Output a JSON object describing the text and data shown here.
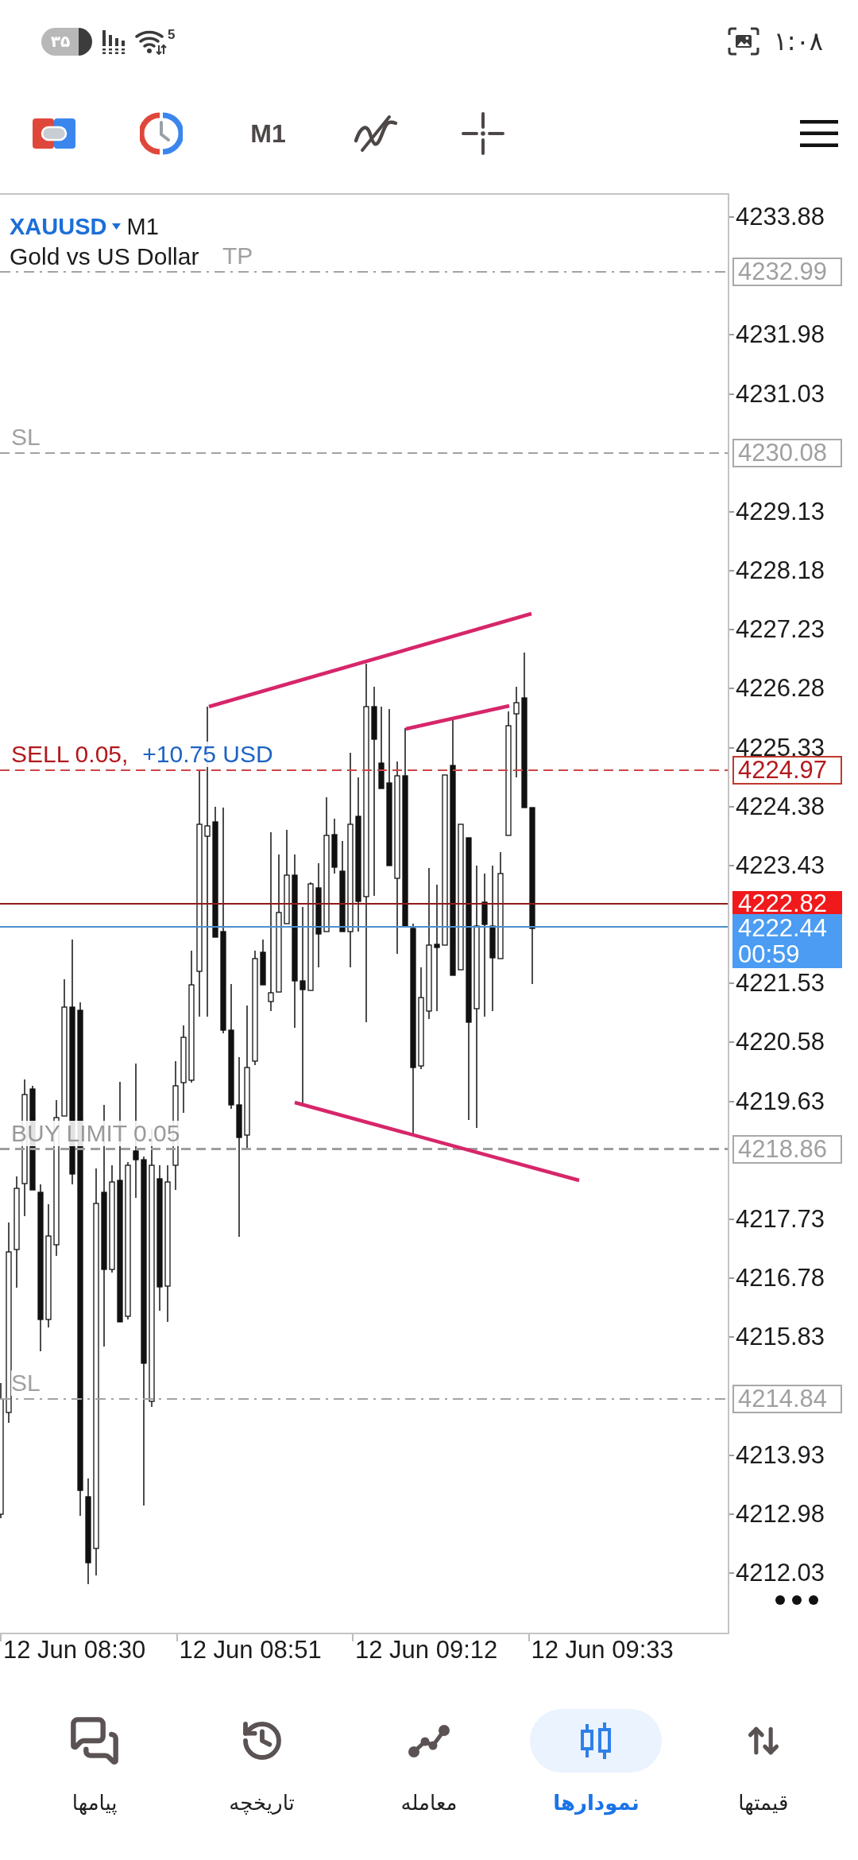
{
  "status_bar": {
    "battery": "۳۵",
    "wifi_generation": "5",
    "time": "۱:۰۸"
  },
  "toolbar": {
    "timeframe": "M1"
  },
  "chart": {
    "symbol": "XAUUSD",
    "timeframe": "M1",
    "description": "Gold vs US Dollar",
    "price_axis": [
      "4233.88",
      "4231.98",
      "4231.03",
      "4229.13",
      "4228.18",
      "4227.23",
      "4226.28",
      "4225.33",
      "4224.38",
      "4223.43",
      "4221.53",
      "4220.58",
      "4219.63",
      "4217.73",
      "4216.78",
      "4215.83",
      "4213.93",
      "4212.98",
      "4212.03"
    ],
    "levels": [
      {
        "kind": "tp",
        "dash_dot": true,
        "label": "TP",
        "price": "4232.99"
      },
      {
        "kind": "sl",
        "dash_dot": false,
        "label": "SL",
        "price": "4230.08"
      },
      {
        "kind": "position",
        "dash_dot": false,
        "label": "SELL 0.05,",
        "profit": "+10.75 USD",
        "price": "4224.97"
      },
      {
        "kind": "bid",
        "price": "4222.82"
      },
      {
        "kind": "ask",
        "price": "4222.44",
        "countdown": "00:59"
      },
      {
        "kind": "pending",
        "dash_dot": false,
        "label": "BUY LIMIT 0.05",
        "price": "4218.86"
      },
      {
        "kind": "sl",
        "dash_dot": true,
        "label": "SL",
        "price": "4214.84"
      }
    ],
    "time_axis": [
      "12 Jun 08:30",
      "12 Jun 08:51",
      "12 Jun 09:12",
      "12 Jun 09:33"
    ]
  },
  "bottom_nav": [
    {
      "label": "قیمتها",
      "selected": false
    },
    {
      "label": "نمودارها",
      "selected": true
    },
    {
      "label": "معامله",
      "selected": false
    },
    {
      "label": "تاریخچه",
      "selected": false
    },
    {
      "label": "پیامها",
      "selected": false
    }
  ]
}
